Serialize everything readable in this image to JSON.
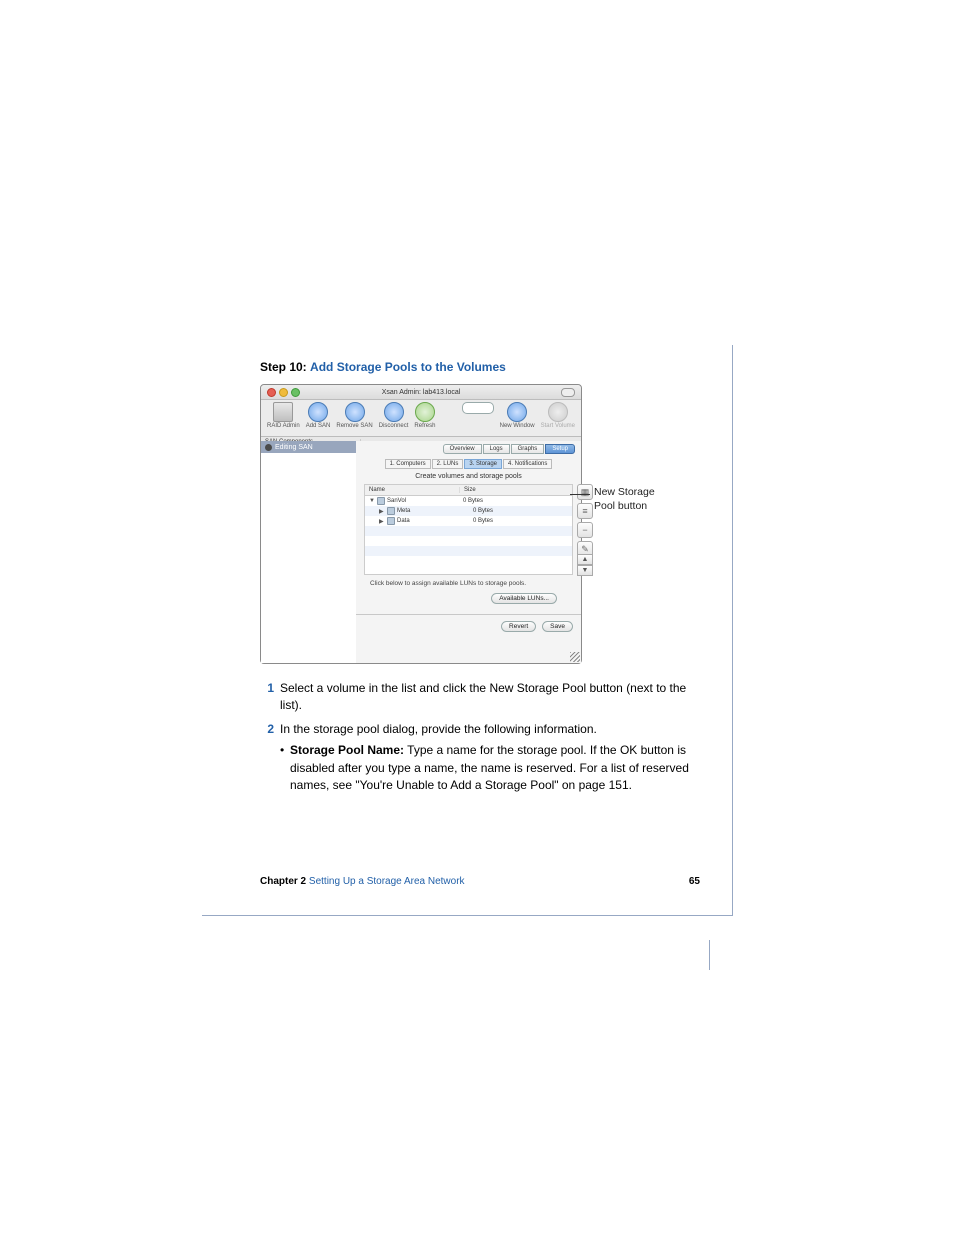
{
  "heading": {
    "step_label": "Step 10:",
    "title": "Add Storage Pools to the Volumes"
  },
  "window": {
    "title": "Xsan Admin: lab413.local",
    "toolbar": {
      "raid": "RAID Admin",
      "add": "Add SAN",
      "remove": "Remove SAN",
      "disconnect": "Disconnect",
      "refresh": "Refresh",
      "newwin": "New Window",
      "start": "Start Volume"
    },
    "sidebar_header": "SAN Components",
    "sidebar_item": "Editing SAN",
    "tabs": {
      "overview": "Overview",
      "logs": "Logs",
      "graphs": "Graphs",
      "setup": "Setup"
    },
    "steps": {
      "s1": "1. Computers",
      "s2": "2. LUNs",
      "s3": "3. Storage",
      "s4": "4. Notifications"
    },
    "subtitle": "Create volumes and storage pools",
    "columns": {
      "name": "Name",
      "size": "Size"
    },
    "rows": [
      {
        "name": "SanVol",
        "size": "0 Bytes",
        "indent": 0,
        "tri": "▼"
      },
      {
        "name": "Meta",
        "size": "0 Bytes",
        "indent": 1,
        "tri": "▶"
      },
      {
        "name": "Data",
        "size": "0 Bytes",
        "indent": 1,
        "tri": "▶"
      }
    ],
    "sidebuttons": {
      "vol": "▦",
      "pool": "≡",
      "minus": "−",
      "edit": "✎"
    },
    "hint": "Click below to assign available LUNs to storage pools.",
    "available_btn": "Available LUNs...",
    "revert_btn": "Revert",
    "save_btn": "Save"
  },
  "callout": {
    "line1": "New Storage",
    "line2": "Pool button"
  },
  "body": {
    "step1": "Select a volume in the list and click the New Storage Pool button (next to the list).",
    "step2": "In the storage pool dialog, provide the following information.",
    "bullet": {
      "label": "Storage Pool Name:",
      "text_a": " Type a name for the storage pool. If the OK button is disabled after you type a name, the name is reserved. For a list of reserved names, see \"You're Unable to Add a Storage Pool\" on page 151."
    }
  },
  "footer": {
    "chapter_label": "Chapter 2",
    "chapter_title": "Setting Up a Storage Area Network",
    "page": "65"
  }
}
